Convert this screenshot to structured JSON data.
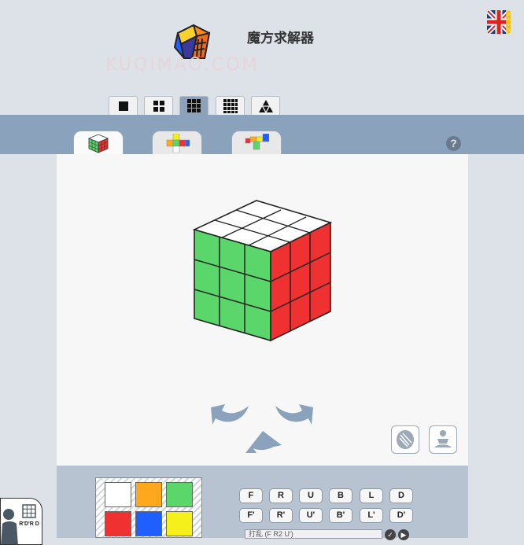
{
  "header": {
    "title": "魔方求解器",
    "watermark": "KUQIMAO.COM",
    "language_icon": "uk-flag-icon"
  },
  "cube_sizes": [
    {
      "name": "2x2-icon",
      "active": false
    },
    {
      "name": "2x2-grid-icon",
      "active": false
    },
    {
      "name": "3x3-grid-icon",
      "active": true
    },
    {
      "name": "4x4-grid-icon",
      "active": false
    },
    {
      "name": "pyramid-icon",
      "active": false
    }
  ],
  "view_tabs": [
    {
      "name": "3d-view-tab",
      "active": true
    },
    {
      "name": "flat-net-view-tab",
      "active": false
    },
    {
      "name": "compact-view-tab",
      "active": false
    }
  ],
  "help": {
    "label": "?"
  },
  "colors": {
    "green": "#5ad66b",
    "red": "#ef3131",
    "white": "#ffffff",
    "orange": "#ffa81e",
    "blue": "#1f5fff",
    "yellow": "#f5f01c",
    "arrow": "#8aa2bb"
  },
  "palette": [
    "#ffffff",
    "#ffa81e",
    "#5ad66b",
    "#ef3131",
    "#1f5fff",
    "#f5f01c"
  ],
  "moves": {
    "row1": [
      "F",
      "R",
      "U",
      "B",
      "L",
      "D"
    ],
    "row2": [
      "F'",
      "R'",
      "U'",
      "B'",
      "L'",
      "D'"
    ]
  },
  "scramble": {
    "text": "打乱 (F R2 U')"
  },
  "controls": {
    "reset": "✓",
    "play": "▶"
  }
}
